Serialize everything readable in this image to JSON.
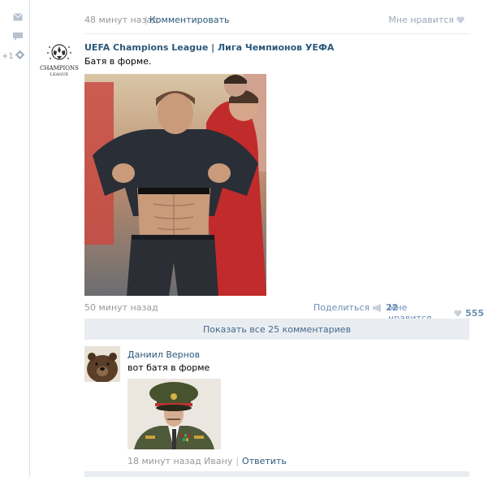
{
  "top_post": {
    "time": "48 минут назад",
    "separator": "|",
    "comment_link": "Комментировать",
    "like_label": "Мне нравится"
  },
  "rail": {
    "plus_counter": "+1",
    "icons": [
      "mail-icon",
      "chat-icon",
      "gear-icon"
    ]
  },
  "post": {
    "author": "UEFA Champions League | Лига Чемпионов УЕФА",
    "avatar_text_line1": "CHAMPIONS",
    "avatar_text_line2": "LEAGUE",
    "text": "Батя в форме.",
    "time": "50 минут назад",
    "share_label": "Поделиться",
    "share_count": "22",
    "like_label": "Мне нравится",
    "like_count": "555"
  },
  "show_all_comments": "Показать все 25 комментариев",
  "comment": {
    "author": "Даниил Вернов",
    "text": "вот батя в форме",
    "time": "18 минут назад Ивану",
    "separator": "|",
    "reply_label": "Ответить"
  },
  "colors": {
    "link": "#2b587a",
    "muted": "#999999",
    "panel": "#e9edf1",
    "rail_icon": "#9aa8b7"
  }
}
